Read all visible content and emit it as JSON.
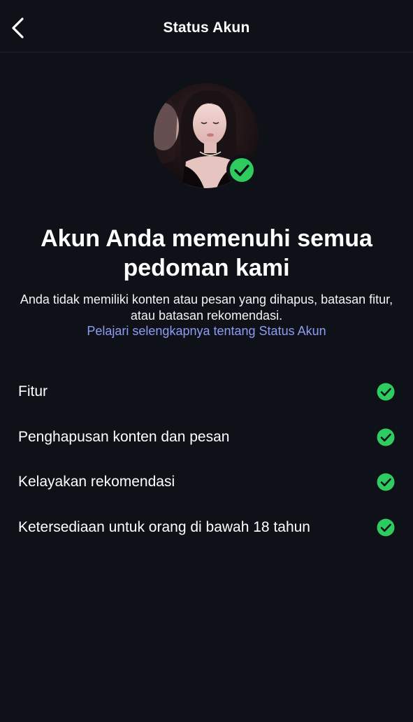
{
  "header": {
    "title": "Status Akun",
    "back_icon": "chevron-left-icon"
  },
  "profile": {
    "badge_icon": "check-circle-icon",
    "badge_color": "#2ecc5f"
  },
  "main": {
    "headline": "Akun Anda memenuhi semua pedoman kami",
    "description": "Anda tidak memiliki konten atau pesan yang dihapus, batasan fitur, atau batasan rekomendasi.",
    "learn_more_link": "Pelajari selengkapnya tentang Status Akun",
    "link_color": "#8f9bf3"
  },
  "status_items": [
    {
      "label": "Fitur",
      "status_icon": "check-circle-icon"
    },
    {
      "label": "Penghapusan konten dan pesan",
      "status_icon": "check-circle-icon"
    },
    {
      "label": "Kelayakan rekomendasi",
      "status_icon": "check-circle-icon"
    },
    {
      "label": "Ketersediaan untuk orang di bawah 18 tahun",
      "status_icon": "check-circle-icon"
    }
  ],
  "colors": {
    "background": "#0e1218",
    "check_green": "#2ecc5f"
  }
}
